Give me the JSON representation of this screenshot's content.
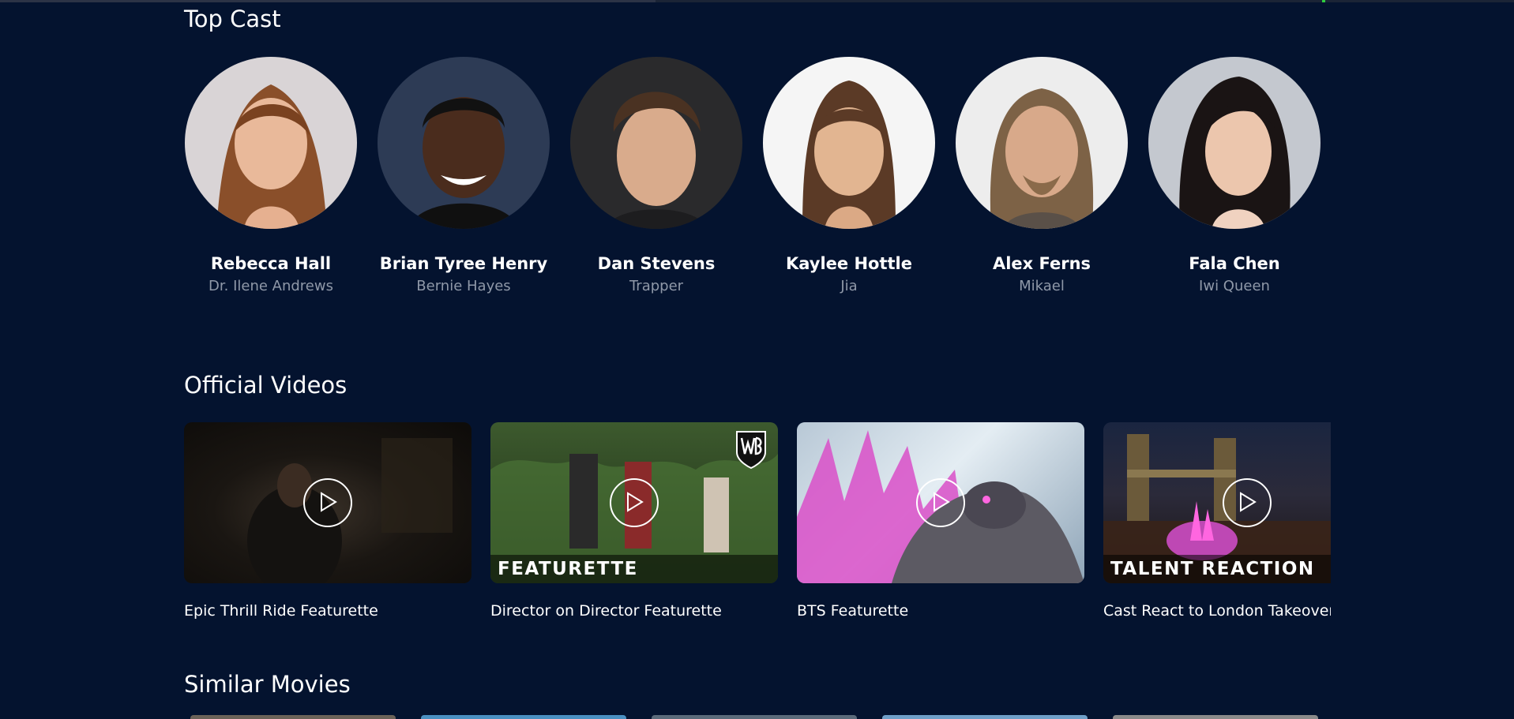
{
  "sections": {
    "top_cast": "Top Cast",
    "official_videos": "Official Videos",
    "similar_movies": "Similar Movies"
  },
  "cast": [
    {
      "name": "Rebecca Hall",
      "role": "Dr. Ilene Andrews"
    },
    {
      "name": "Brian Tyree Henry",
      "role": "Bernie Hayes"
    },
    {
      "name": "Dan Stevens",
      "role": "Trapper"
    },
    {
      "name": "Kaylee Hottle",
      "role": "Jia"
    },
    {
      "name": "Alex Ferns",
      "role": "Mikael"
    },
    {
      "name": "Fala Chen",
      "role": "Iwi Queen"
    }
  ],
  "videos": [
    {
      "title": "Epic Thrill Ride Featurette",
      "banner": ""
    },
    {
      "title": "Director on Director Featurette",
      "banner": "FEATURETTE"
    },
    {
      "title": "BTS Featurette",
      "banner": ""
    },
    {
      "title": "Cast React to London Takeover",
      "banner": "TALENT REACTION"
    }
  ],
  "colors": {
    "background": "#04132f",
    "text_primary": "#ffffff",
    "text_secondary": "#8f98a8"
  },
  "icons": {
    "play": "play-icon",
    "studio_logo": "wb-logo-icon"
  }
}
